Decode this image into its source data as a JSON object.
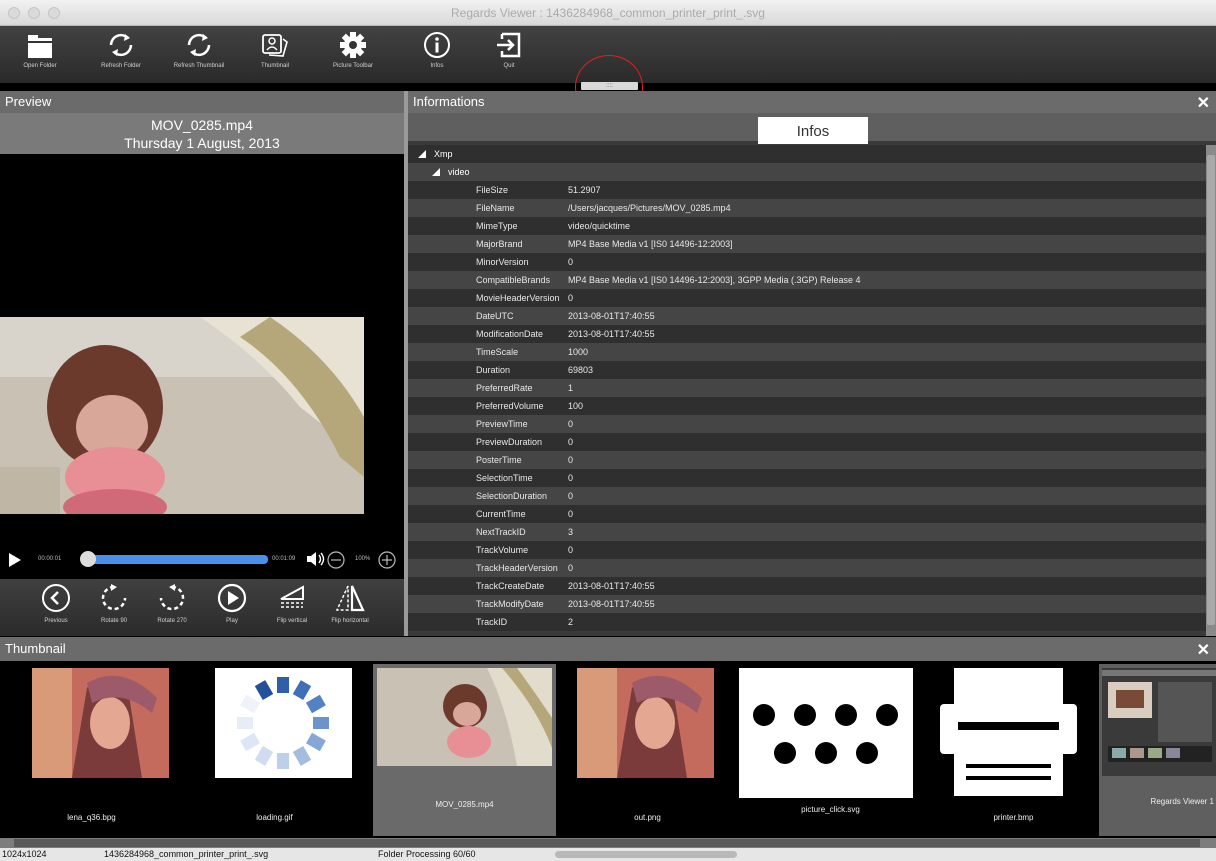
{
  "window": {
    "title": "Regards Viewer : 1436284968_common_printer_print_.svg"
  },
  "toolbar": {
    "items": [
      {
        "label": "Open Folder",
        "icon": "folder-icon"
      },
      {
        "label": "Refresh Folder",
        "icon": "refresh-icon"
      },
      {
        "label": "Refresh Thumbnail",
        "icon": "refresh-icon"
      },
      {
        "label": "Thumbnail",
        "icon": "thumbnail-icon"
      },
      {
        "label": "Picture Toolbar",
        "icon": "gear-icon"
      },
      {
        "label": "Infos",
        "icon": "info-icon"
      },
      {
        "label": "Quit",
        "icon": "exit-icon"
      }
    ],
    "handle_label": "::::"
  },
  "preview": {
    "header": "Preview",
    "filename": "MOV_0285.mp4",
    "date": "Thursday 1 August, 2013",
    "player": {
      "current": "00:00:01",
      "total": "00:01:09",
      "volume": "100%",
      "progress": 0.02
    },
    "toolbar": [
      {
        "label": "Previous",
        "icon": "chevron-left-icon"
      },
      {
        "label": "Rotate 90",
        "icon": "rotate-left-icon"
      },
      {
        "label": "Rotate 270",
        "icon": "rotate-right-icon"
      },
      {
        "label": "Play",
        "icon": "play-icon"
      },
      {
        "label": "Flip vertical",
        "icon": "flip-vertical-icon"
      },
      {
        "label": "Flip horizontal",
        "icon": "flip-horizontal-icon"
      }
    ]
  },
  "info": {
    "header": "Informations",
    "tab": "Infos",
    "root": "Xmp",
    "group": "video",
    "rows": [
      {
        "key": "FileSize",
        "value": "51.2907"
      },
      {
        "key": "FileName",
        "value": "/Users/jacques/Pictures/MOV_0285.mp4"
      },
      {
        "key": "MimeType",
        "value": "video/quicktime"
      },
      {
        "key": "MajorBrand",
        "value": "MP4 Base Media v1 [IS0 14496-12:2003]"
      },
      {
        "key": "MinorVersion",
        "value": "0"
      },
      {
        "key": "CompatibleBrands",
        "value": "MP4 Base Media v1 [IS0 14496-12:2003], 3GPP Media (.3GP) Release 4"
      },
      {
        "key": "MovieHeaderVersion",
        "value": "0"
      },
      {
        "key": "DateUTC",
        "value": "2013-08-01T17:40:55"
      },
      {
        "key": "ModificationDate",
        "value": "2013-08-01T17:40:55"
      },
      {
        "key": "TimeScale",
        "value": "1000"
      },
      {
        "key": "Duration",
        "value": "69803"
      },
      {
        "key": "PreferredRate",
        "value": "1"
      },
      {
        "key": "PreferredVolume",
        "value": "100"
      },
      {
        "key": "PreviewTime",
        "value": "0"
      },
      {
        "key": "PreviewDuration",
        "value": "0"
      },
      {
        "key": "PosterTime",
        "value": "0"
      },
      {
        "key": "SelectionTime",
        "value": "0"
      },
      {
        "key": "SelectionDuration",
        "value": "0"
      },
      {
        "key": "CurrentTime",
        "value": "0"
      },
      {
        "key": "NextTrackID",
        "value": "3"
      },
      {
        "key": "TrackVolume",
        "value": "0"
      },
      {
        "key": "TrackHeaderVersion",
        "value": "0"
      },
      {
        "key": "TrackCreateDate",
        "value": "2013-08-01T17:40:55"
      },
      {
        "key": "TrackModifyDate",
        "value": "2013-08-01T17:40:55"
      },
      {
        "key": "TrackID",
        "value": "2"
      }
    ]
  },
  "thumbnails": {
    "header": "Thumbnail",
    "items": [
      {
        "caption": "lena_q36.bpg"
      },
      {
        "caption": "loading.gif"
      },
      {
        "caption": "MOV_0285.mp4"
      },
      {
        "caption": "out.png"
      },
      {
        "caption": "picture_click.svg"
      },
      {
        "caption": "printer.bmp"
      },
      {
        "caption": "Regards Viewer 1"
      }
    ]
  },
  "status": {
    "size": "1024x1024",
    "file": "1436284968_common_printer_print_.svg",
    "processing": "Folder Processing 60/60"
  },
  "colors": {
    "accent": "#4a90e8",
    "panel_header": "#6b6b6b",
    "annotation": "#e02020"
  }
}
